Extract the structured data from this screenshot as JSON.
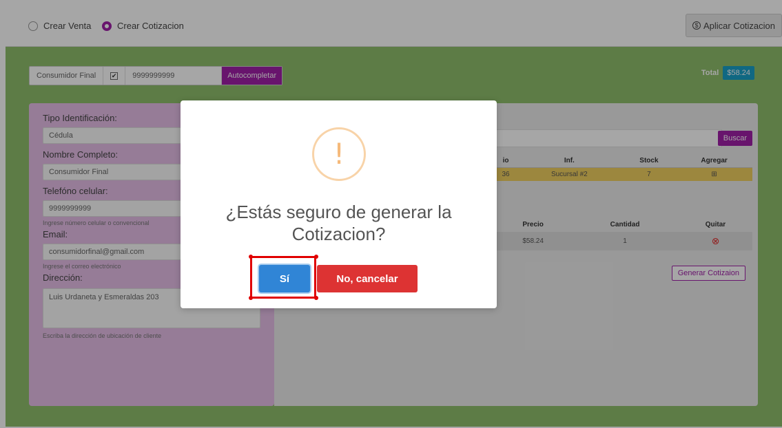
{
  "topbar": {
    "radio_venta": "Crear Venta",
    "radio_cotizacion": "Crear Cotizacion",
    "apply_button": "Aplicar Cotizacion",
    "apply_icon": "dollar-circle-icon"
  },
  "client_bar": {
    "name": "Consumidor Final",
    "checkbox": "✔",
    "phone": "9999999999",
    "autocomplete": "Autocompletar"
  },
  "total": {
    "label": "Total",
    "value": "$58.24"
  },
  "form": {
    "tipo_label": "Tipo Identificación:",
    "tipo_value": "Cédula",
    "nombre_label": "Nombre Completo:",
    "nombre_value": "Consumidor Final",
    "telefono_label": "Telefóno celular:",
    "telefono_value": "9999999999",
    "telefono_help": "Ingrese número celular o convencional",
    "email_label": "Email:",
    "email_value": "consumidorfinal@gmail.com",
    "email_help": "Ingrese el correo electrónico",
    "direccion_label": "Dirección:",
    "direccion_value": "Luis Urdaneta y Esmeraldas 203",
    "direccion_help": "Escriba la dirección de ubicación de cliente"
  },
  "products": {
    "search_button": "Buscar",
    "headers": [
      "io",
      "Inf.",
      "Stock",
      "Agregar"
    ],
    "row": [
      "36",
      "Sucursal #2",
      "7",
      "⊞"
    ]
  },
  "cart": {
    "headers": [
      "Precio",
      "Cantidad",
      "Quitar"
    ],
    "row": {
      "precio": "$58.24",
      "cantidad": "1",
      "quitar": "⊗"
    },
    "generate_button": "Generar Cotizaion"
  },
  "modal": {
    "icon": "!",
    "title": "¿Estás seguro de generar la Cotizacion?",
    "confirm": "Sí",
    "cancel": "No, cancelar"
  },
  "colors": {
    "accent": "#a020a8",
    "green_bg": "#8fbf6c",
    "confirm_blue": "#3085d6",
    "cancel_red": "#dd3333",
    "highlight": "#e00000"
  }
}
